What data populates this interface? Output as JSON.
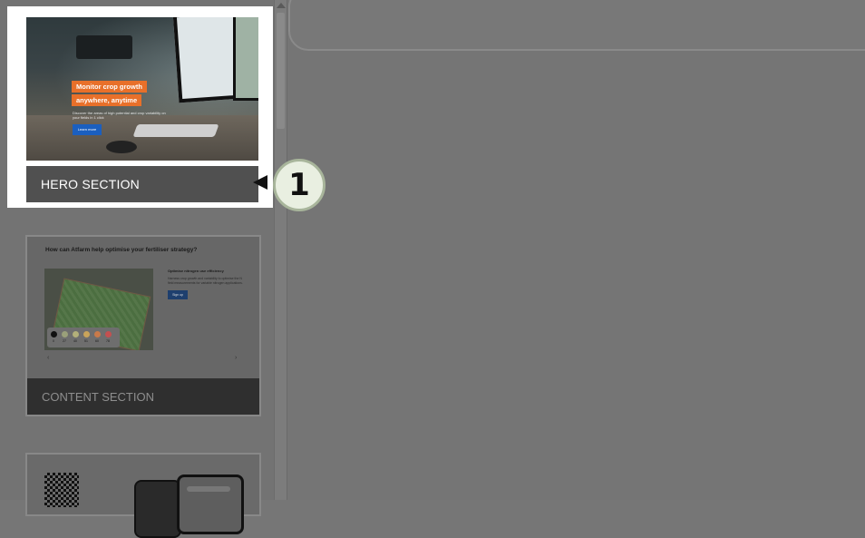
{
  "sections": [
    {
      "id": "hero",
      "label": "HERO SECTION",
      "preview": {
        "headline_line1": "Monitor crop growth",
        "headline_line2": "anywhere, anytime",
        "subtext": "Discover the areas of high potential and crop variability on your fields in 1 click",
        "button": "Learn more"
      }
    },
    {
      "id": "content",
      "label": "CONTENT SECTION",
      "preview": {
        "title": "How can Atfarm help optimise your fertiliser strategy?",
        "side_title": "Optimise nitrogen use efficiency",
        "side_text": "Harness crop growth and variability to optimise the N field measurements for variable nitrogen applications.",
        "button": "Sign up",
        "legend": [
          {
            "value": "0",
            "color": "#111111"
          },
          {
            "value": "27",
            "color": "#9aa07a"
          },
          {
            "value": "40",
            "color": "#b3b07a"
          },
          {
            "value": "51",
            "color": "#c9a45a"
          },
          {
            "value": "60",
            "color": "#c97a4a"
          },
          {
            "value": "78",
            "color": "#c45050"
          }
        ],
        "prev": "‹",
        "next": "›"
      }
    }
  ],
  "callout": {
    "number": "1"
  },
  "colors": {
    "accent_orange": "#e8702a",
    "button_blue": "#1b5fbf"
  }
}
